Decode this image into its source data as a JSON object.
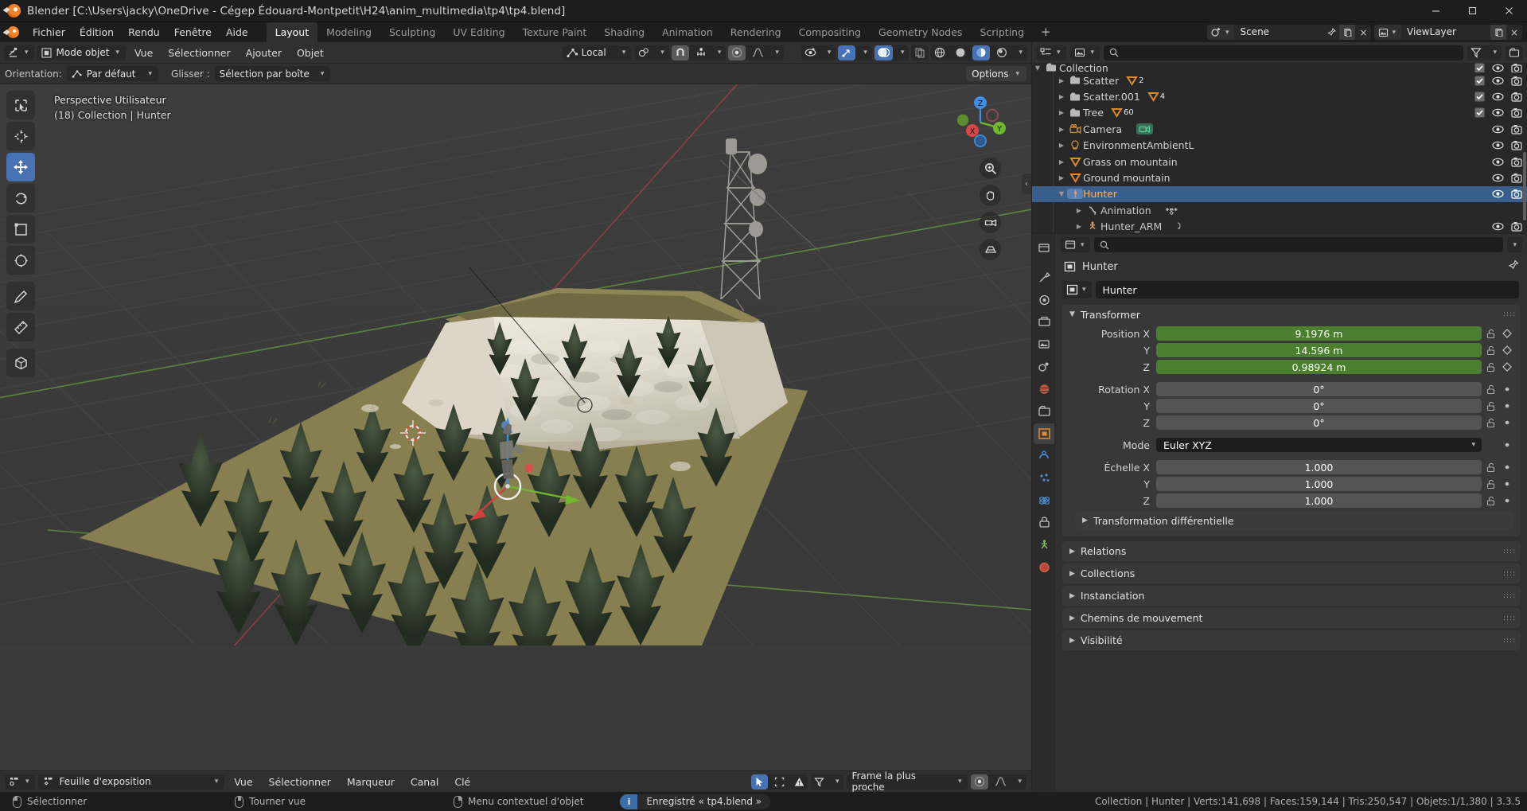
{
  "window": {
    "title": "Blender [C:\\Users\\jacky\\OneDrive - Cégep Édouard-Montpetit\\H24\\anim_multimedia\\tp4\\tp4.blend]",
    "minimize": "minimize-icon",
    "maximize": "maximize-icon",
    "close": "close-icon"
  },
  "topbar": {
    "menus": [
      "Fichier",
      "Édition",
      "Rendu",
      "Fenêtre",
      "Aide"
    ],
    "workspaces": [
      {
        "label": "Layout",
        "active": true
      },
      {
        "label": "Modeling",
        "active": false
      },
      {
        "label": "Sculpting",
        "active": false
      },
      {
        "label": "UV Editing",
        "active": false
      },
      {
        "label": "Texture Paint",
        "active": false
      },
      {
        "label": "Shading",
        "active": false
      },
      {
        "label": "Animation",
        "active": false
      },
      {
        "label": "Rendering",
        "active": false
      },
      {
        "label": "Compositing",
        "active": false
      },
      {
        "label": "Geometry Nodes",
        "active": false
      },
      {
        "label": "Scripting",
        "active": false
      }
    ],
    "add_workspace": "+",
    "scene_name": "Scene",
    "viewlayer_name": "ViewLayer"
  },
  "viewport_header": {
    "mode": "Mode objet",
    "menus": [
      "Vue",
      "Sélectionner",
      "Ajouter",
      "Objet"
    ],
    "transform_orientation": "Local",
    "snap_icon": "magnet-icon",
    "proportional_icon": "proportional-edit-icon"
  },
  "viewport_tool": {
    "orientation_label": "Orientation:",
    "orientation_value": "Par défaut",
    "drag_label": "Glisser :",
    "drag_value": "Sélection par boîte",
    "options_label": "Options"
  },
  "viewport": {
    "line1": "Perspective Utilisateur",
    "line2": "(18) Collection | Hunter",
    "gizmo_axes": [
      "X",
      "Y",
      "Z"
    ],
    "tools": [
      "tweak-select-tool",
      "cursor-tool",
      "move-tool",
      "rotate-tool",
      "scale-tool",
      "transform-tool",
      "annotate-tool",
      "measure-tool",
      "add-cube-tool"
    ]
  },
  "timeline": {
    "editor_type": "dope-sheet-icon",
    "mode": "Feuille d'exposition",
    "menus": [
      "Vue",
      "Sélectionner",
      "Marqueur",
      "Canal",
      "Clé"
    ],
    "snap_value": "Frame la plus proche"
  },
  "outliner": {
    "display_mode": "view-layer-icon",
    "search_placeholder": "",
    "filter_icon": "filter-icon",
    "rows": [
      {
        "name": "Collection",
        "indent": 0,
        "icon": "collection-icon",
        "tri": "down",
        "checkbox": true,
        "eye": true,
        "camera": true,
        "badge": "",
        "count": "",
        "selected": false,
        "partial": true
      },
      {
        "name": "Scatter",
        "indent": 1,
        "icon": "collection-icon",
        "tri": "right",
        "checkbox": true,
        "eye": true,
        "camera": true,
        "badge": "mesh-data-icon",
        "count": "2",
        "selected": false
      },
      {
        "name": "Scatter.001",
        "indent": 1,
        "icon": "collection-icon",
        "tri": "right",
        "checkbox": true,
        "eye": true,
        "camera": true,
        "badge": "mesh-data-icon",
        "count": "4",
        "selected": false
      },
      {
        "name": "Tree",
        "indent": 1,
        "icon": "collection-icon",
        "tri": "right",
        "checkbox": true,
        "eye": true,
        "camera": true,
        "badge": "mesh-data-icon",
        "count": "60",
        "selected": false
      },
      {
        "name": "Camera",
        "indent": 1,
        "icon": "camera-object-icon",
        "tri": "right",
        "checkbox": false,
        "eye": true,
        "camera": true,
        "badge": "camera-data-icon",
        "count": "",
        "selected": false
      },
      {
        "name": "EnvironmentAmbientL",
        "indent": 1,
        "icon": "light-object-icon",
        "tri": "right",
        "checkbox": false,
        "eye": true,
        "camera": true,
        "badge": "",
        "count": "",
        "selected": false
      },
      {
        "name": "Grass on mountain",
        "indent": 1,
        "icon": "mesh-object-icon",
        "tri": "right",
        "checkbox": false,
        "eye": true,
        "camera": true,
        "badge": "",
        "count": "",
        "selected": false
      },
      {
        "name": "Ground mountain",
        "indent": 1,
        "icon": "mesh-object-icon",
        "tri": "right",
        "checkbox": false,
        "eye": true,
        "camera": true,
        "badge": "",
        "count": "",
        "selected": false
      },
      {
        "name": "Hunter",
        "indent": 1,
        "icon": "armature-object-icon",
        "tri": "down",
        "checkbox": false,
        "eye": true,
        "camera": true,
        "badge": "",
        "count": "",
        "selected": true
      },
      {
        "name": "Animation",
        "indent": 2,
        "icon": "animation-icon",
        "tri": "right",
        "checkbox": false,
        "eye": false,
        "camera": false,
        "badge": "keyframes-icon",
        "count": "",
        "selected": false
      },
      {
        "name": "Hunter_ARM",
        "indent": 2,
        "icon": "armature-data-icon",
        "tri": "right",
        "checkbox": false,
        "eye": true,
        "camera": true,
        "badge": "pose-icon",
        "count": "",
        "selected": false
      }
    ]
  },
  "properties": {
    "breadcrumb": "Hunter",
    "object_name": "Hunter",
    "tabs": [
      "tool-tab",
      "render-tab",
      "output-tab",
      "view-layer-tab",
      "scene-tab",
      "world-tab",
      "collection-tab",
      "object-tab",
      "modifiers-tab",
      "particles-tab",
      "physics-tab",
      "constraints-tab",
      "data-tab",
      "material-tab"
    ],
    "active_tab": "object-tab",
    "transform_panel": "Transformer",
    "fields": [
      {
        "label": "Position X",
        "value": "9.1976 m",
        "style": "green",
        "key": "diamond"
      },
      {
        "label": "Y",
        "value": "14.596 m",
        "style": "green",
        "key": "diamond"
      },
      {
        "label": "Z",
        "value": "0.98924 m",
        "style": "green",
        "key": "diamond"
      },
      {
        "label": "Rotation X",
        "value": "0°",
        "style": "grey",
        "key": "dot"
      },
      {
        "label": "Y",
        "value": "0°",
        "style": "grey",
        "key": "dot"
      },
      {
        "label": "Z",
        "value": "0°",
        "style": "grey",
        "key": "dot"
      },
      {
        "label": "Mode",
        "value": "Euler XYZ",
        "style": "dark",
        "key": "dot"
      },
      {
        "label": "Échelle X",
        "value": "1.000",
        "style": "grey",
        "key": "dot"
      },
      {
        "label": "Y",
        "value": "1.000",
        "style": "grey",
        "key": "dot"
      },
      {
        "label": "Z",
        "value": "1.000",
        "style": "grey",
        "key": "dot"
      }
    ],
    "sub_panel": "Transformation différentielle",
    "closed_panels": [
      "Relations",
      "Collections",
      "Instanciation",
      "Chemins de mouvement",
      "Visibilité"
    ]
  },
  "statusbar": {
    "items": [
      {
        "mouse": "left",
        "label": "Sélectionner"
      },
      {
        "mouse": "middle",
        "label": "Tourner vue"
      },
      {
        "mouse": "right",
        "label": "Menu contextuel d'objet"
      }
    ],
    "saved_icon": "info-icon",
    "saved_text": "Enregistré «  tp4.blend  »",
    "stats": "Collection | Hunter | Verts:141,698 | Faces:159,144 | Tris:250,547 | Objets:1/1,380 | 3.3.5"
  },
  "colors": {
    "accent": "#4772b3",
    "green_field": "#4a7f2f",
    "orange": "#e08a30",
    "bg": "#303030"
  }
}
